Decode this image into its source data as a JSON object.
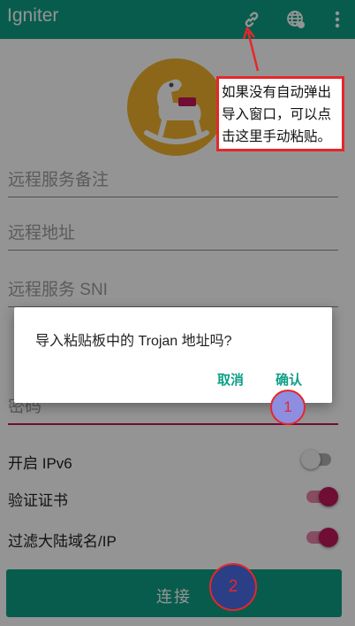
{
  "app": {
    "title": "Igniter",
    "actions": [
      "link-icon",
      "globe-icon",
      "more-vert-icon"
    ]
  },
  "colors": {
    "primary": "#0f9f86",
    "accent": "#c2185b",
    "annotation": "#e6262a"
  },
  "form": {
    "remark_placeholder": "远程服务备注",
    "address_placeholder": "远程地址",
    "sni_placeholder": "远程服务 SNI",
    "password_placeholder": "密码"
  },
  "toggles": [
    {
      "label": "开启 IPv6",
      "on": false
    },
    {
      "label": "验证证书",
      "on": true
    },
    {
      "label": "过滤大陆域名/IP",
      "on": true
    }
  ],
  "connect_button": {
    "label": "连接"
  },
  "dialog": {
    "message": "导入粘贴板中的 Trojan 地址吗?",
    "cancel_label": "取消",
    "confirm_label": "确认"
  },
  "annotations": {
    "callout_text": "如果没有自动弹出导入窗口，可以点击这里手动粘贴。",
    "marker_1": "1",
    "marker_2": "2"
  }
}
